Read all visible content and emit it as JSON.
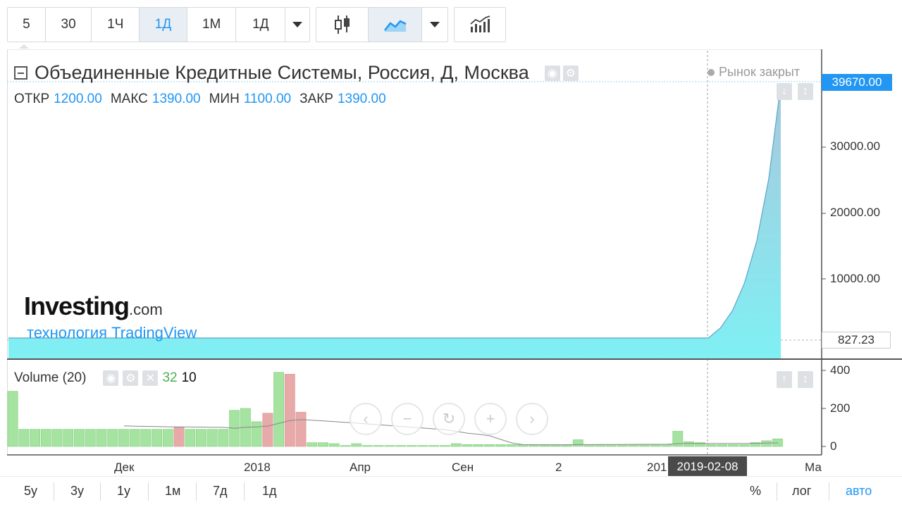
{
  "toolbar": {
    "intervals": [
      "5",
      "30",
      "1Ч",
      "1Д",
      "1М",
      "1Д"
    ],
    "active_interval_index": 3
  },
  "legend": {
    "title": "Объединенные Кредитные Системы, Россия, Д, Москва",
    "market_status": "Рынок закрыт",
    "ohlc": [
      {
        "key": "ОТКР",
        "value": "1200.00"
      },
      {
        "key": "МАКС",
        "value": "1390.00"
      },
      {
        "key": "МИН",
        "value": "1100.00"
      },
      {
        "key": "ЗАКР",
        "value": "1390.00"
      }
    ]
  },
  "price_axis": {
    "labels": [
      "30000.00",
      "20000.00",
      "10000.00"
    ],
    "last_price": "39670.00",
    "crosshair_price": "827.23",
    "volume_labels": [
      "400",
      "200",
      "0"
    ]
  },
  "volume": {
    "title": "Volume (20)",
    "value_up": "32",
    "value_down": "10"
  },
  "time_axis": {
    "labels": [
      "Дек",
      "2018",
      "Апр",
      "Сен",
      "2",
      "201",
      "Ма"
    ],
    "crosshair_date": "2019-02-08"
  },
  "watermark": {
    "brand": "Investing",
    "suffix": ".com",
    "tagline": "технология TradingView"
  },
  "bottom_bar": {
    "ranges": [
      "5у",
      "3у",
      "1у",
      "1м",
      "7д",
      "1д"
    ],
    "percent": "%",
    "log": "лог",
    "auto": "авто"
  },
  "colors": {
    "accent": "#2196f3",
    "area_fill": "#7ff0f4",
    "area_line": "#5aa6c8",
    "volume_up": "#a5e3a0",
    "volume_down": "#e8a9a9"
  },
  "chart_data": {
    "type": "area",
    "series": [
      {
        "name": "Объединенные Кредитные Системы",
        "values": [
          1300,
          1300,
          1300,
          1300,
          1300,
          1300,
          1300,
          1300,
          1300,
          1300,
          1300,
          1300,
          1300,
          1300,
          1300,
          1300,
          1300,
          1300,
          1300,
          1300,
          1200,
          1100,
          1100,
          1100,
          1100,
          1050,
          1050,
          1050,
          1050,
          1050,
          1050,
          1050,
          1050,
          1050,
          1000,
          1000,
          1000,
          1000,
          1000,
          1000,
          1000,
          1000,
          1000,
          1000,
          1000,
          1000,
          1000,
          1000,
          1000,
          1000,
          1000,
          1000,
          1000,
          1050,
          1100,
          1200,
          1500,
          2000,
          3000,
          4500,
          7000,
          11000,
          17000,
          26000,
          39670
        ]
      }
    ],
    "ylim": [
      0,
      40000
    ],
    "volume": [
      290,
      90,
      90,
      90,
      90,
      90,
      90,
      90,
      90,
      90,
      90,
      90,
      90,
      90,
      90,
      100,
      90,
      90,
      90,
      90,
      190,
      200,
      130,
      175,
      390,
      380,
      180,
      20,
      20,
      15,
      5,
      15,
      5,
      5,
      5,
      5,
      5,
      5,
      5,
      5,
      15,
      10,
      10,
      10,
      10,
      10,
      10,
      10,
      10,
      10,
      10,
      35,
      10,
      10,
      10,
      10,
      10,
      10,
      10,
      10,
      80,
      25,
      20,
      10,
      10,
      10,
      10,
      20,
      30,
      40
    ]
  }
}
